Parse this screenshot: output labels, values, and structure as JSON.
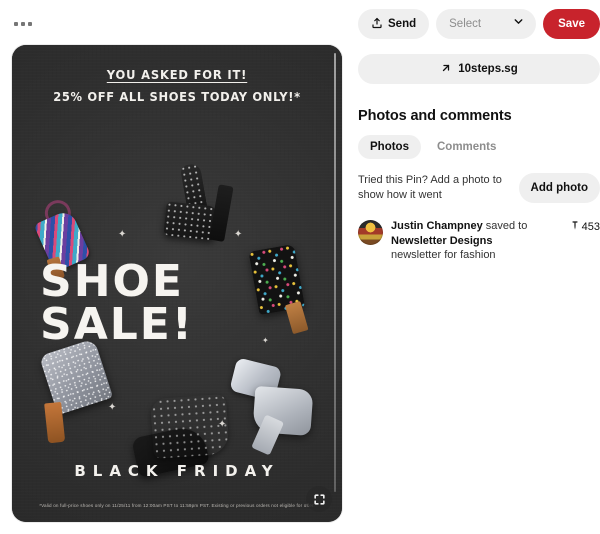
{
  "overflow_menu": {
    "name": "more options"
  },
  "actions": {
    "send_label": "Send",
    "select_placeholder": "Select",
    "save_label": "Save"
  },
  "source_link": {
    "label": "10steps.sg"
  },
  "photos_and_comments": {
    "heading": "Photos and comments",
    "tabs": [
      {
        "label": "Photos",
        "active": true
      },
      {
        "label": "Comments",
        "active": false
      }
    ],
    "prompt": "Tried this Pin? Add a photo to show how it went",
    "add_photo_label": "Add photo",
    "activity": {
      "user": "Justin Champney",
      "verb": " saved to",
      "board": "Newsletter Designs",
      "note": "newsletter for fashion",
      "save_count": "453"
    }
  },
  "pin_image": {
    "headline_1": "YOU ASKED FOR IT!",
    "headline_2": "25% OFF ALL SHOES TODAY ONLY!*",
    "title_line_1": "SHOE",
    "title_line_2": "SALE!",
    "footer": "BLACK FRIDAY",
    "fineprint": "*Valid on full-price shoes only on 11/25/11 from 12:00am PST to 11:59pm PST. Existing or previous orders not eligible for offer.",
    "expand_label": "Expand Pin"
  },
  "colors": {
    "save_red": "#c8232c",
    "chip_gray": "#efefef",
    "pin_bg": "#2e2e2e",
    "muted_text": "#8d8d8d"
  }
}
